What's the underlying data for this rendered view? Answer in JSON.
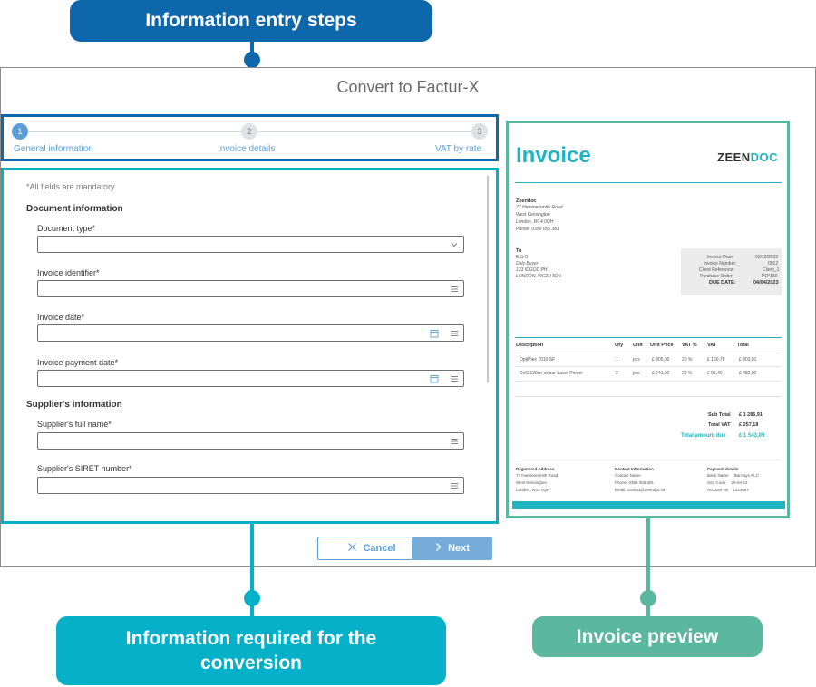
{
  "callouts": {
    "steps": "Information entry steps",
    "info": "Information required for the conversion",
    "preview": "Invoice preview"
  },
  "colors": {
    "steps_blue": "#0f67ab",
    "info_cyan": "#05b0c8",
    "preview_green": "#5bb89e",
    "accent": "#5b9fd6",
    "invoice_teal": "#1fb4bf"
  },
  "dialog": {
    "title": "Convert to Factur-X"
  },
  "stepper": {
    "steps": [
      {
        "number": "1",
        "label": "General information",
        "state": "active"
      },
      {
        "number": "2",
        "label": "Invoice details",
        "state": "inactive"
      },
      {
        "number": "3",
        "label": "VAT by rate",
        "state": "inactive"
      }
    ]
  },
  "form": {
    "mandatory_note": "*All fields are mandatory",
    "document_section": "Document information",
    "supplier_section": "Supplier's information",
    "fields": [
      {
        "label": "Document type*",
        "value": "",
        "icon": "chevron-down-icon"
      },
      {
        "label": "Invoice identifier*",
        "value": "",
        "icon": "menu-lines-icon"
      },
      {
        "label": "Invoice date*",
        "value": "",
        "icon": "calendar-icon"
      },
      {
        "label": "Invoice payment date*",
        "value": "",
        "icon": "calendar-icon"
      },
      {
        "label": "Supplier's full name*",
        "value": "",
        "icon": "menu-lines-icon"
      },
      {
        "label": "Supplier's SIRET number*",
        "value": "",
        "icon": "menu-lines-icon"
      }
    ]
  },
  "buttons": {
    "cancel": "Cancel",
    "next": "Next"
  },
  "invoice": {
    "title": "Invoice",
    "logo": {
      "left": "ZEEN",
      "right": "DOC"
    },
    "supplier": {
      "name": "Zeendoc",
      "lines": [
        "77 Hammersmith Road",
        "West Kensington",
        "London, W14 0QH",
        "Phone: 0356 055 381"
      ]
    },
    "to": {
      "label": "To",
      "name": "E.S.O",
      "lines": [
        "Daly Buyer",
        "133 IDGOD PH",
        "LONDON, WC2N 5DU"
      ]
    },
    "summary": [
      {
        "label": "Invoice Date:",
        "value": "03/12/2023"
      },
      {
        "label": "Invoice Number:",
        "value": "0012"
      },
      {
        "label": "Client Reference:",
        "value": "Client_1"
      },
      {
        "label": "Purchase Order:",
        "value": "PO°150"
      },
      {
        "label": "DUE DATE:",
        "value": "04/04/2023"
      }
    ],
    "table_headers": [
      "Description",
      "Qty",
      "Unit",
      "Unit Price",
      "VAT %",
      "VAT",
      "Total"
    ],
    "table_rows": [
      [
        "OptiPlex 7010 SF",
        "1",
        "pcs",
        "£ 805,00",
        "20 %",
        "£ 160,78",
        "£ 803,91"
      ],
      [
        "Dell2130cn colour Laser Printer",
        "2",
        "pcs",
        "£ 241,00",
        "20 %",
        "£ 96,40",
        "£ 482,00"
      ]
    ],
    "totals": [
      {
        "label": "Sub Total",
        "value": "£ 1 285,91"
      },
      {
        "label": "Total VAT",
        "value": "£ 257,18"
      },
      {
        "label": "Total amount due",
        "value": "£ 1 543,09"
      }
    ],
    "footer": [
      {
        "title": "Registered Address",
        "lines": [
          "77 Hammersmith Road",
          "West Kensington",
          "London, W14 0QH"
        ]
      },
      {
        "title": "Contact Information",
        "lines": [
          "Contact Name",
          "Phone: 0356 055 381",
          "Email: contact@zeendoc.uk"
        ]
      },
      {
        "title": "Payment details",
        "lines": [
          "Bank Name     Barclays PLC",
          "Sort Code     20-64-12",
          "Account No    1234567"
        ]
      }
    ]
  }
}
